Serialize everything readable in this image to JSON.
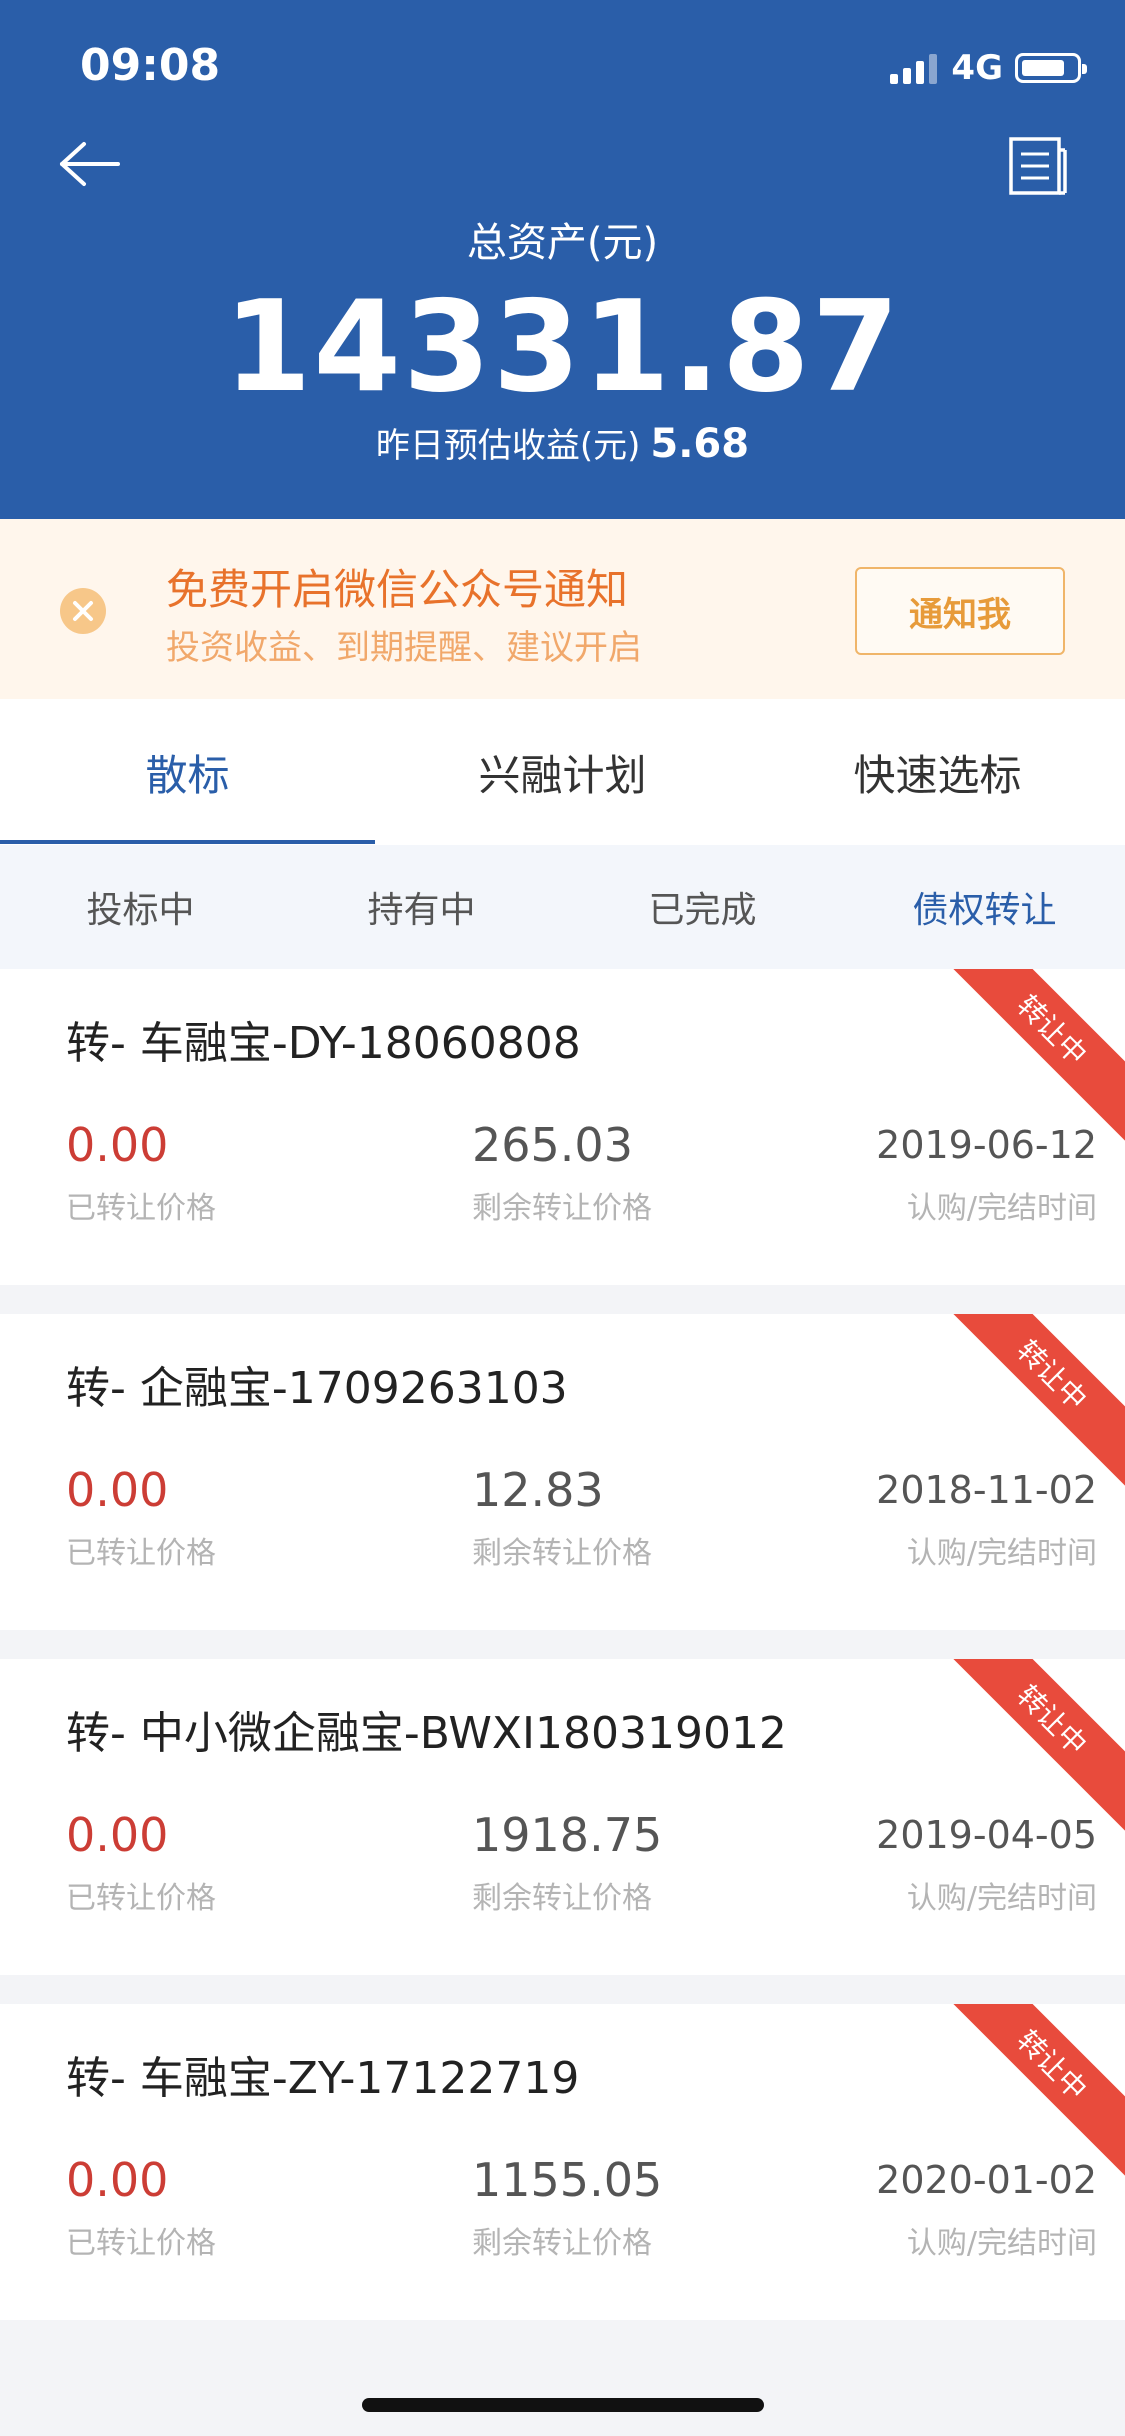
{
  "status": {
    "time": "09:08",
    "network": "4G"
  },
  "header": {
    "total_label": "总资产(元)",
    "total_value": "14331.87",
    "yesterday_label": "昨日预估收益(元)",
    "yesterday_value": "5.68"
  },
  "notice": {
    "title": "免费开启微信公众号通知",
    "subtitle": "投资收益、到期提醒、建议开启",
    "button": "通知我"
  },
  "tabs": [
    "散标",
    "兴融计划",
    "快速选标"
  ],
  "subtabs": [
    "投标中",
    "持有中",
    "已完成",
    "债权转让"
  ],
  "list": {
    "labels": {
      "transferred": "已转让价格",
      "remaining": "剩余转让价格",
      "time": "认购/完结时间"
    },
    "items": [
      {
        "title": "转- 车融宝-DY-18060808",
        "transferred": "0.00",
        "remaining": "265.03",
        "date": "2019-06-12",
        "badge": "转让中"
      },
      {
        "title": "转- 企融宝-1709263103",
        "transferred": "0.00",
        "remaining": "12.83",
        "date": "2018-11-02",
        "badge": "转让中"
      },
      {
        "title": "转- 中小微企融宝-BWXI180319012",
        "transferred": "0.00",
        "remaining": "1918.75",
        "date": "2019-04-05",
        "badge": "转让中"
      },
      {
        "title": "转- 车融宝-ZY-17122719",
        "transferred": "0.00",
        "remaining": "1155.05",
        "date": "2020-01-02",
        "badge": "转让中"
      }
    ]
  },
  "colors": {
    "brand": "#2a5ea9",
    "accent_red": "#e84b3c",
    "notice_orange": "#e8722b"
  }
}
